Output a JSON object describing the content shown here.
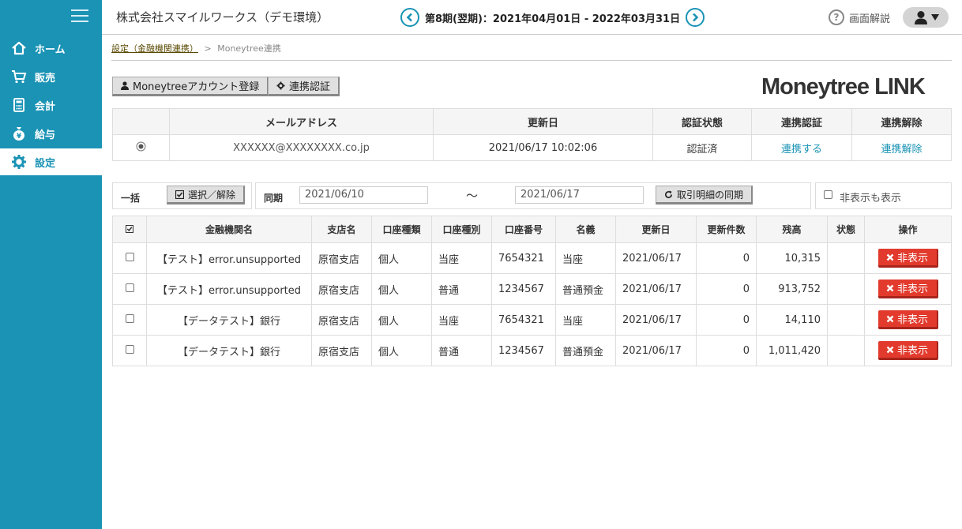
{
  "header": {
    "company": "株式会社スマイルワークス（デモ環境）",
    "period": "第8期(翌期)：2021年04月01日 - 2022年03月31日",
    "help_label": "画面解説"
  },
  "sidebar": {
    "items": [
      {
        "label": "ホーム",
        "icon": "home-icon"
      },
      {
        "label": "販売",
        "icon": "cart-icon"
      },
      {
        "label": "会計",
        "icon": "calculator-icon"
      },
      {
        "label": "給与",
        "icon": "moneybag-icon"
      },
      {
        "label": "設定",
        "icon": "gear-icon"
      }
    ],
    "active": "設定"
  },
  "breadcrumb": {
    "parent": "設定（金融機関連携）",
    "separator": ">",
    "current": "Moneytree連携"
  },
  "toolbar": {
    "account_register_label": "Moneytreeアカウント登録",
    "auth_label": "連携認証"
  },
  "logo_text": "Moneytree LINK",
  "account_table": {
    "headers": [
      "メールアドレス",
      "更新日",
      "認証状態",
      "連携認証",
      "連携解除"
    ],
    "row": {
      "email": "XXXXXX@XXXXXXXX.co.jp",
      "updated": "2021/06/17 10:02:06",
      "status": "認証済",
      "link_action": "連携する",
      "unlink_action": "連携解除"
    }
  },
  "filter": {
    "bulk_label": "一括",
    "select_toggle_label": "選択／解除",
    "sync_label": "同期",
    "date_from": "2021/06/10",
    "tilde": "〜",
    "date_to": "2021/06/17",
    "sync_button_label": "取引明細の同期",
    "show_hidden_label": "非表示も表示"
  },
  "accounts": {
    "headers": [
      "金融機関名",
      "支店名",
      "口座種類",
      "口座種別",
      "口座番号",
      "名義",
      "更新日",
      "更新件数",
      "残高",
      "状態",
      "操作"
    ],
    "hide_label": "非表示",
    "rows": [
      {
        "bank": "【テスト】error.unsupported",
        "branch": "原宿支店",
        "kind": "個人",
        "type": "当座",
        "number": "7654321",
        "holder": "当座",
        "updated": "2021/06/17",
        "count": "0",
        "balance": "10,315",
        "state": ""
      },
      {
        "bank": "【テスト】error.unsupported",
        "branch": "原宿支店",
        "kind": "個人",
        "type": "普通",
        "number": "1234567",
        "holder": "普通預金",
        "updated": "2021/06/17",
        "count": "0",
        "balance": "913,752",
        "state": ""
      },
      {
        "bank": "【データテスト】銀行",
        "branch": "原宿支店",
        "kind": "個人",
        "type": "当座",
        "number": "7654321",
        "holder": "当座",
        "updated": "2021/06/17",
        "count": "0",
        "balance": "14,110",
        "state": ""
      },
      {
        "bank": "【データテスト】銀行",
        "branch": "原宿支店",
        "kind": "個人",
        "type": "普通",
        "number": "1234567",
        "holder": "普通預金",
        "updated": "2021/06/17",
        "count": "0",
        "balance": "1,011,420",
        "state": ""
      }
    ]
  }
}
